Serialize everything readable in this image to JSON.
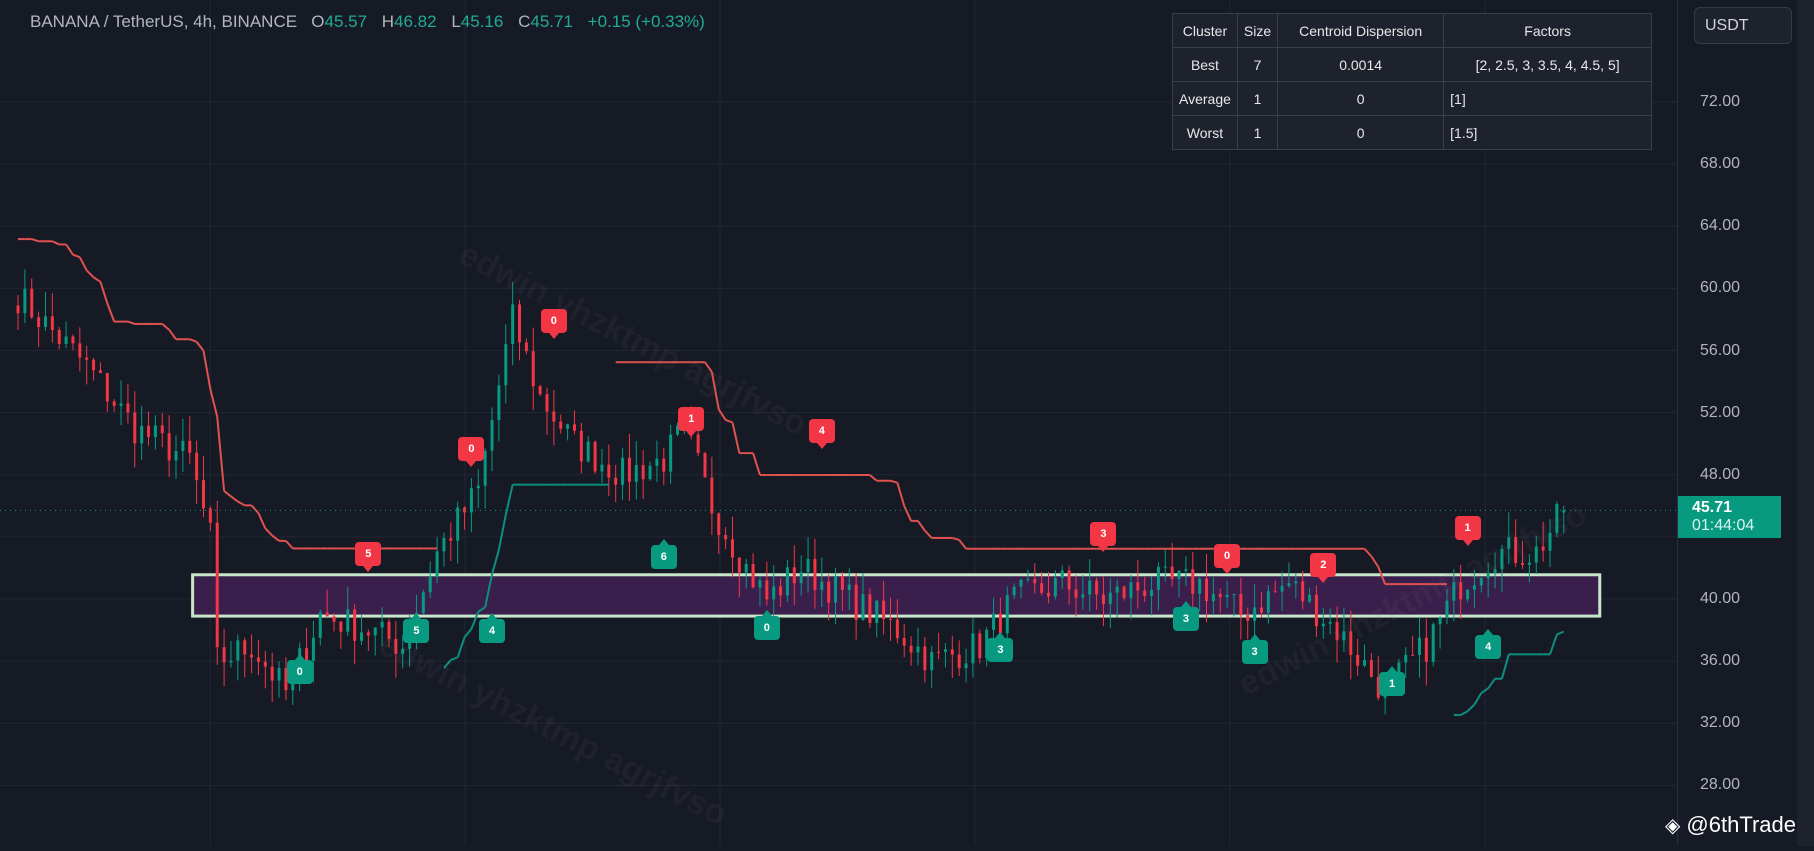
{
  "header": {
    "symbol": "BANANA / TetherUS, 4h, BINANCE",
    "o_label": "O",
    "o": "45.57",
    "h_label": "H",
    "h": "46.82",
    "l_label": "L",
    "l": "45.16",
    "c_label": "C",
    "c": "45.71",
    "change": "+0.15 (+0.33%)"
  },
  "currency_button": "USDT",
  "last_price": {
    "value": "45.71",
    "countdown": "01:44:04",
    "color": "#089981"
  },
  "watermark": "edwin yhzktmp agrjfvso",
  "brand": "@6thTrade",
  "table": {
    "headers": [
      "Cluster",
      "Size",
      "Centroid Dispersion",
      "Factors"
    ],
    "rows": [
      [
        "Best",
        "7",
        "0.0014",
        "[2, 2.5, 3, 3.5, 4, 4.5, 5]"
      ],
      [
        "Average",
        "1",
        "0",
        "[1]"
      ],
      [
        "Worst",
        "1",
        "0",
        "[1.5]"
      ]
    ]
  },
  "colors": {
    "up": "#089981",
    "down": "#f23645",
    "bg": "#161a25",
    "zone_fill": "#3a1f4d",
    "zone_border": "#c8e6c9"
  },
  "chart_data": {
    "type": "candlestick",
    "bars": 225,
    "ylim": [
      24,
      74
    ],
    "y_ticks": [
      "72.00",
      "68.00",
      "64.00",
      "60.00",
      "56.00",
      "52.00",
      "48.00",
      "40.00",
      "36.00",
      "32.00",
      "28.00"
    ],
    "close_keypoints": [
      [
        0,
        59.5
      ],
      [
        10,
        55
      ],
      [
        17,
        51
      ],
      [
        25,
        49
      ],
      [
        28,
        44
      ],
      [
        29,
        36
      ],
      [
        34,
        37
      ],
      [
        39,
        34
      ],
      [
        44,
        39
      ],
      [
        51,
        38
      ],
      [
        56,
        37
      ],
      [
        61,
        43
      ],
      [
        67,
        47
      ],
      [
        71,
        56
      ],
      [
        72,
        58
      ],
      [
        76,
        53
      ],
      [
        81,
        50
      ],
      [
        88,
        48
      ],
      [
        94,
        49
      ],
      [
        97,
        51
      ],
      [
        101,
        46
      ],
      [
        106,
        42
      ],
      [
        109,
        40
      ],
      [
        114,
        42
      ],
      [
        121,
        40
      ],
      [
        128,
        38
      ],
      [
        133,
        36
      ],
      [
        140,
        37
      ],
      [
        145,
        40
      ],
      [
        152,
        41
      ],
      [
        158,
        40
      ],
      [
        165,
        41
      ],
      [
        172,
        41
      ],
      [
        178,
        39
      ],
      [
        185,
        41
      ],
      [
        192,
        38
      ],
      [
        199,
        34
      ],
      [
        205,
        37
      ],
      [
        210,
        41
      ],
      [
        215,
        43
      ],
      [
        221,
        43
      ],
      [
        225,
        45.71
      ]
    ],
    "zone": {
      "bar_start": 26,
      "bar_end": 232,
      "top": 41.56,
      "bottom": 38.9
    },
    "sell_signals": [
      {
        "bar": 51,
        "price": 41.6,
        "label": "5"
      },
      {
        "bar": 66,
        "price": 48.4,
        "label": "0"
      },
      {
        "bar": 78,
        "price": 56.6,
        "label": "0"
      },
      {
        "bar": 98,
        "price": 50.3,
        "label": "1"
      },
      {
        "bar": 117,
        "price": 49.5,
        "label": "4"
      },
      {
        "bar": 158,
        "price": 42.9,
        "label": "3"
      },
      {
        "bar": 176,
        "price": 41.5,
        "label": "0"
      },
      {
        "bar": 190,
        "price": 40.9,
        "label": "2"
      },
      {
        "bar": 211,
        "price": 43.3,
        "label": "1"
      }
    ],
    "buy_signals": [
      {
        "bar": 41,
        "price": 36.6,
        "label": "0"
      },
      {
        "bar": 58,
        "price": 39.2,
        "label": "5"
      },
      {
        "bar": 69,
        "price": 39.2,
        "label": "4"
      },
      {
        "bar": 94,
        "price": 44.0,
        "label": "6"
      },
      {
        "bar": 109,
        "price": 39.4,
        "label": "0"
      },
      {
        "bar": 143,
        "price": 38.0,
        "label": "3"
      },
      {
        "bar": 170,
        "price": 40.0,
        "label": "3"
      },
      {
        "bar": 180,
        "price": 37.9,
        "label": "3"
      },
      {
        "bar": 200,
        "price": 35.8,
        "label": "1"
      },
      {
        "bar": 214,
        "price": 38.2,
        "label": "4"
      }
    ]
  }
}
